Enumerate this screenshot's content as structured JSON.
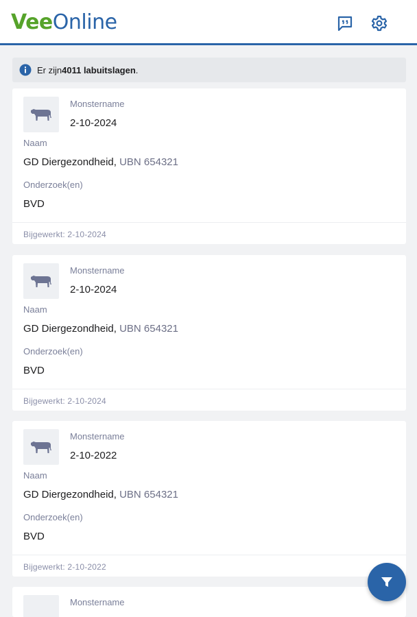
{
  "header": {
    "logo_part1": "Vee",
    "logo_part2": "Online",
    "feedback_icon": "feedback-icon",
    "settings_icon": "gear-icon"
  },
  "banner": {
    "prefix": "Er zijn ",
    "count": "4011 labuitslagen",
    "suffix": "."
  },
  "cards": [
    {
      "sample_label": "Monstername",
      "sample_date": "2-10-2024",
      "name_label": "Naam",
      "name": "GD Diergezondheid, ",
      "ubn": "UBN 654321",
      "tests_label": "Onderzoek(en)",
      "tests": "BVD",
      "updated": "Bijgewerkt: 2-10-2024"
    },
    {
      "sample_label": "Monstername",
      "sample_date": "2-10-2024",
      "name_label": "Naam",
      "name": "GD Diergezondheid, ",
      "ubn": "UBN 654321",
      "tests_label": "Onderzoek(en)",
      "tests": "BVD",
      "updated": "Bijgewerkt: 2-10-2024"
    },
    {
      "sample_label": "Monstername",
      "sample_date": "2-10-2022",
      "name_label": "Naam",
      "name": "GD Diergezondheid, ",
      "ubn": "UBN 654321",
      "tests_label": "Onderzoek(en)",
      "tests": "BVD",
      "updated": "Bijgewerkt: 2-10-2022"
    },
    {
      "sample_label": "Monstername"
    }
  ],
  "colors": {
    "brand_green": "#56a32a",
    "brand_blue": "#2a64a8"
  },
  "fab_icon": "filter-icon"
}
